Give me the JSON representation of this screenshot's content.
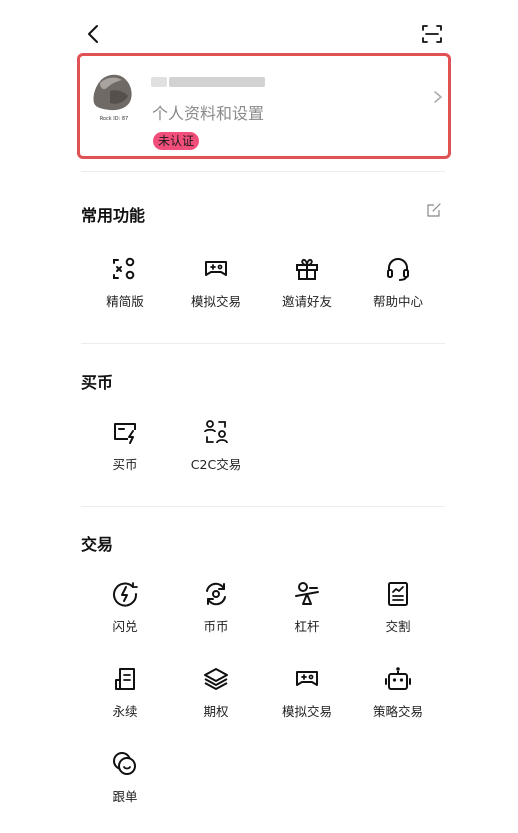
{
  "profile": {
    "subtitle": "个人资料和设置",
    "badge": "未认证",
    "avatar_caption": "Rock ID: 87"
  },
  "sections": {
    "common": {
      "title": "常用功能",
      "items": [
        "精简版",
        "模拟交易",
        "邀请好友",
        "帮助中心"
      ]
    },
    "buy": {
      "title": "买币",
      "items": [
        "买币",
        "C2C交易"
      ]
    },
    "trade": {
      "title": "交易",
      "items": [
        "闪兑",
        "币币",
        "杠杆",
        "交割",
        "永续",
        "期权",
        "模拟交易",
        "策略交易",
        "跟单"
      ]
    }
  },
  "icons": {
    "back": "back-arrow-icon",
    "scan": "scan-icon",
    "edit": "edit-icon"
  },
  "colors": {
    "highlight_border": "#e05253",
    "badge_bg": "#f24e7c"
  }
}
